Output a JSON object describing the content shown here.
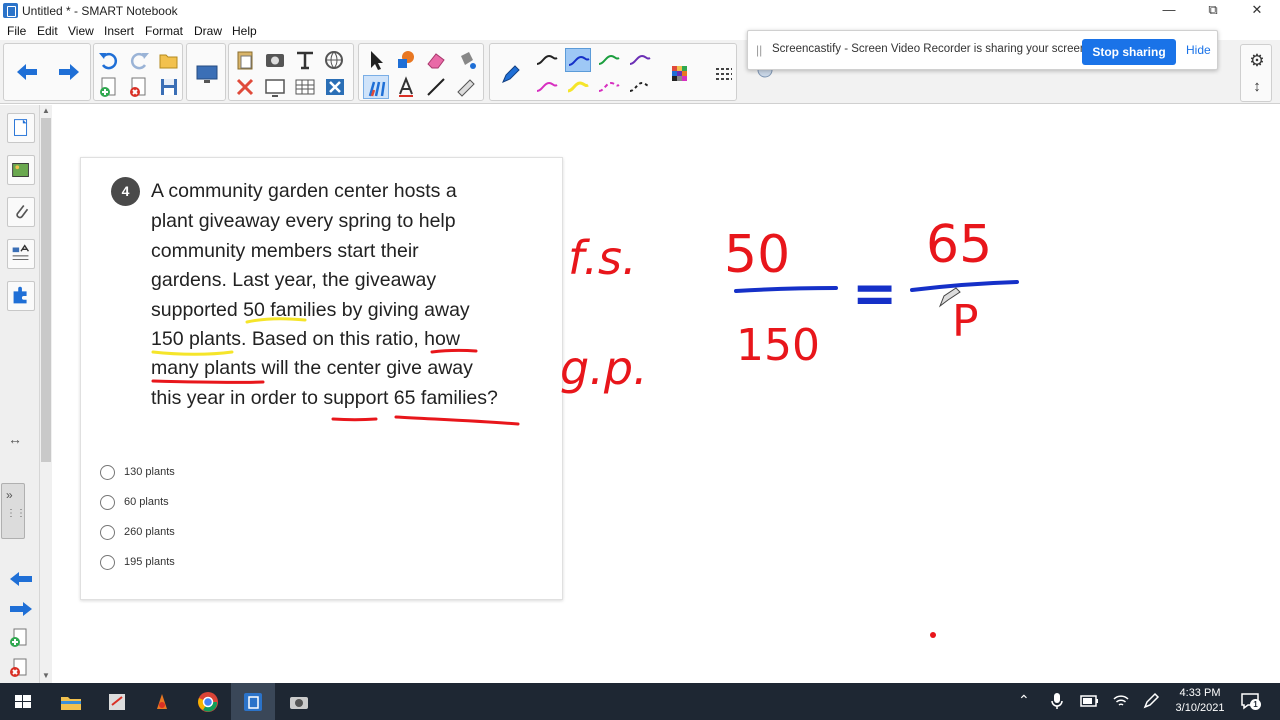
{
  "window": {
    "title": "Untitled * - SMART Notebook"
  },
  "menu": [
    "File",
    "Edit",
    "View",
    "Insert",
    "Format",
    "Draw",
    "Help"
  ],
  "notification": {
    "message": "Screencastify - Screen Video Recorder is sharing your screen.",
    "stop_label": "Stop sharing",
    "hide_label": "Hide"
  },
  "question": {
    "number": "4",
    "lines": [
      "A community garden center hosts a",
      "plant giveaway every spring to help",
      "community members start their",
      "gardens. Last year, the giveaway",
      "supported 50 families by giving away",
      "150 plants. Based on this ratio, how",
      "many plants will the center give away",
      "this year in order to support 65 families?"
    ],
    "options": [
      "130 plants",
      "60 plants",
      "260 plants",
      "195 plants"
    ]
  },
  "handwriting": {
    "label_top": "f.s.",
    "label_bottom": "g.p.",
    "left_numerator": "50",
    "left_denominator": "150",
    "equals": "=",
    "right_numerator": "65",
    "right_denominator": "P"
  },
  "taskbar": {
    "time": "4:33 PM",
    "date": "3/10/2021",
    "notification_count": "1"
  },
  "colors": {
    "ink_red": "#e8161b",
    "ink_blue": "#1530c8",
    "highlight_yellow": "#f5e52a",
    "accent": "#1a73e8"
  }
}
